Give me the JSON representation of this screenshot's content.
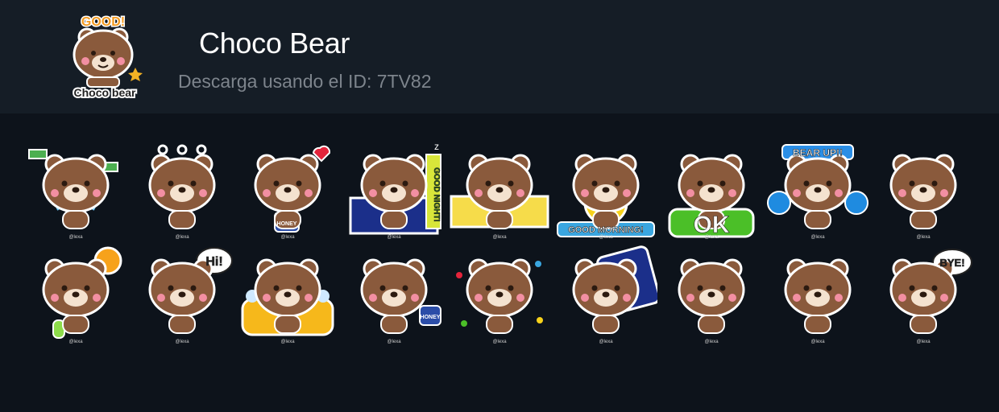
{
  "pack": {
    "title": "Choco Bear",
    "subtitle": "Descarga usando el ID: 7TV82",
    "logo": {
      "badge_text": "GOOD!",
      "caption": "Choco bear"
    }
  },
  "colors": {
    "background": "#0d131b",
    "header_background": "#151d26",
    "bear_fur": "#8a5a3c",
    "bear_muzzle": "#f4e2cf",
    "outline": "#4a2e1e",
    "sticker_border": "#ffffff"
  },
  "stickers": [
    {
      "name": "crying-money-flying",
      "text": "",
      "variant": "cry"
    },
    {
      "name": "silent-dots",
      "text": "",
      "variant": "dots"
    },
    {
      "name": "honey-heart",
      "text": "",
      "variant": "honey",
      "prop_text": "HONEY"
    },
    {
      "name": "good-night-bed",
      "text": "GOOD NIGHT!",
      "variant": "sleep"
    },
    {
      "name": "peeking-over-wall",
      "text": "",
      "variant": "peek"
    },
    {
      "name": "good-morning-sun",
      "text": "GOOD MORNING!",
      "variant": "sun"
    },
    {
      "name": "ok-sign",
      "text": "OK",
      "variant": "ok"
    },
    {
      "name": "bear-up-cheer",
      "text": "BEAR UP!!",
      "variant": "cheer"
    },
    {
      "name": "big-grin",
      "text": "",
      "variant": "grin"
    },
    {
      "name": "hot-sun-sweating",
      "text": "",
      "variant": "hot"
    },
    {
      "name": "hi-greeting",
      "text": "Hi!",
      "variant": "hi"
    },
    {
      "name": "bath-tub",
      "text": "",
      "variant": "bath"
    },
    {
      "name": "lying-honey-jar",
      "text": "",
      "variant": "lying",
      "prop_text": "HONEY"
    },
    {
      "name": "cheering-confetti",
      "text": "",
      "variant": "yay"
    },
    {
      "name": "starry-night-phone",
      "text": "",
      "variant": "night"
    },
    {
      "name": "tongue-out",
      "text": "",
      "variant": "tongue"
    },
    {
      "name": "sparkle-eyes-scared",
      "text": "",
      "variant": "scared"
    },
    {
      "name": "bye-wave",
      "text": "BYE!",
      "variant": "bye"
    }
  ],
  "icons": {
    "logo": "choco-bear-logo-icon",
    "sticker": "bear-sticker-icon",
    "signature": "@lexa"
  }
}
